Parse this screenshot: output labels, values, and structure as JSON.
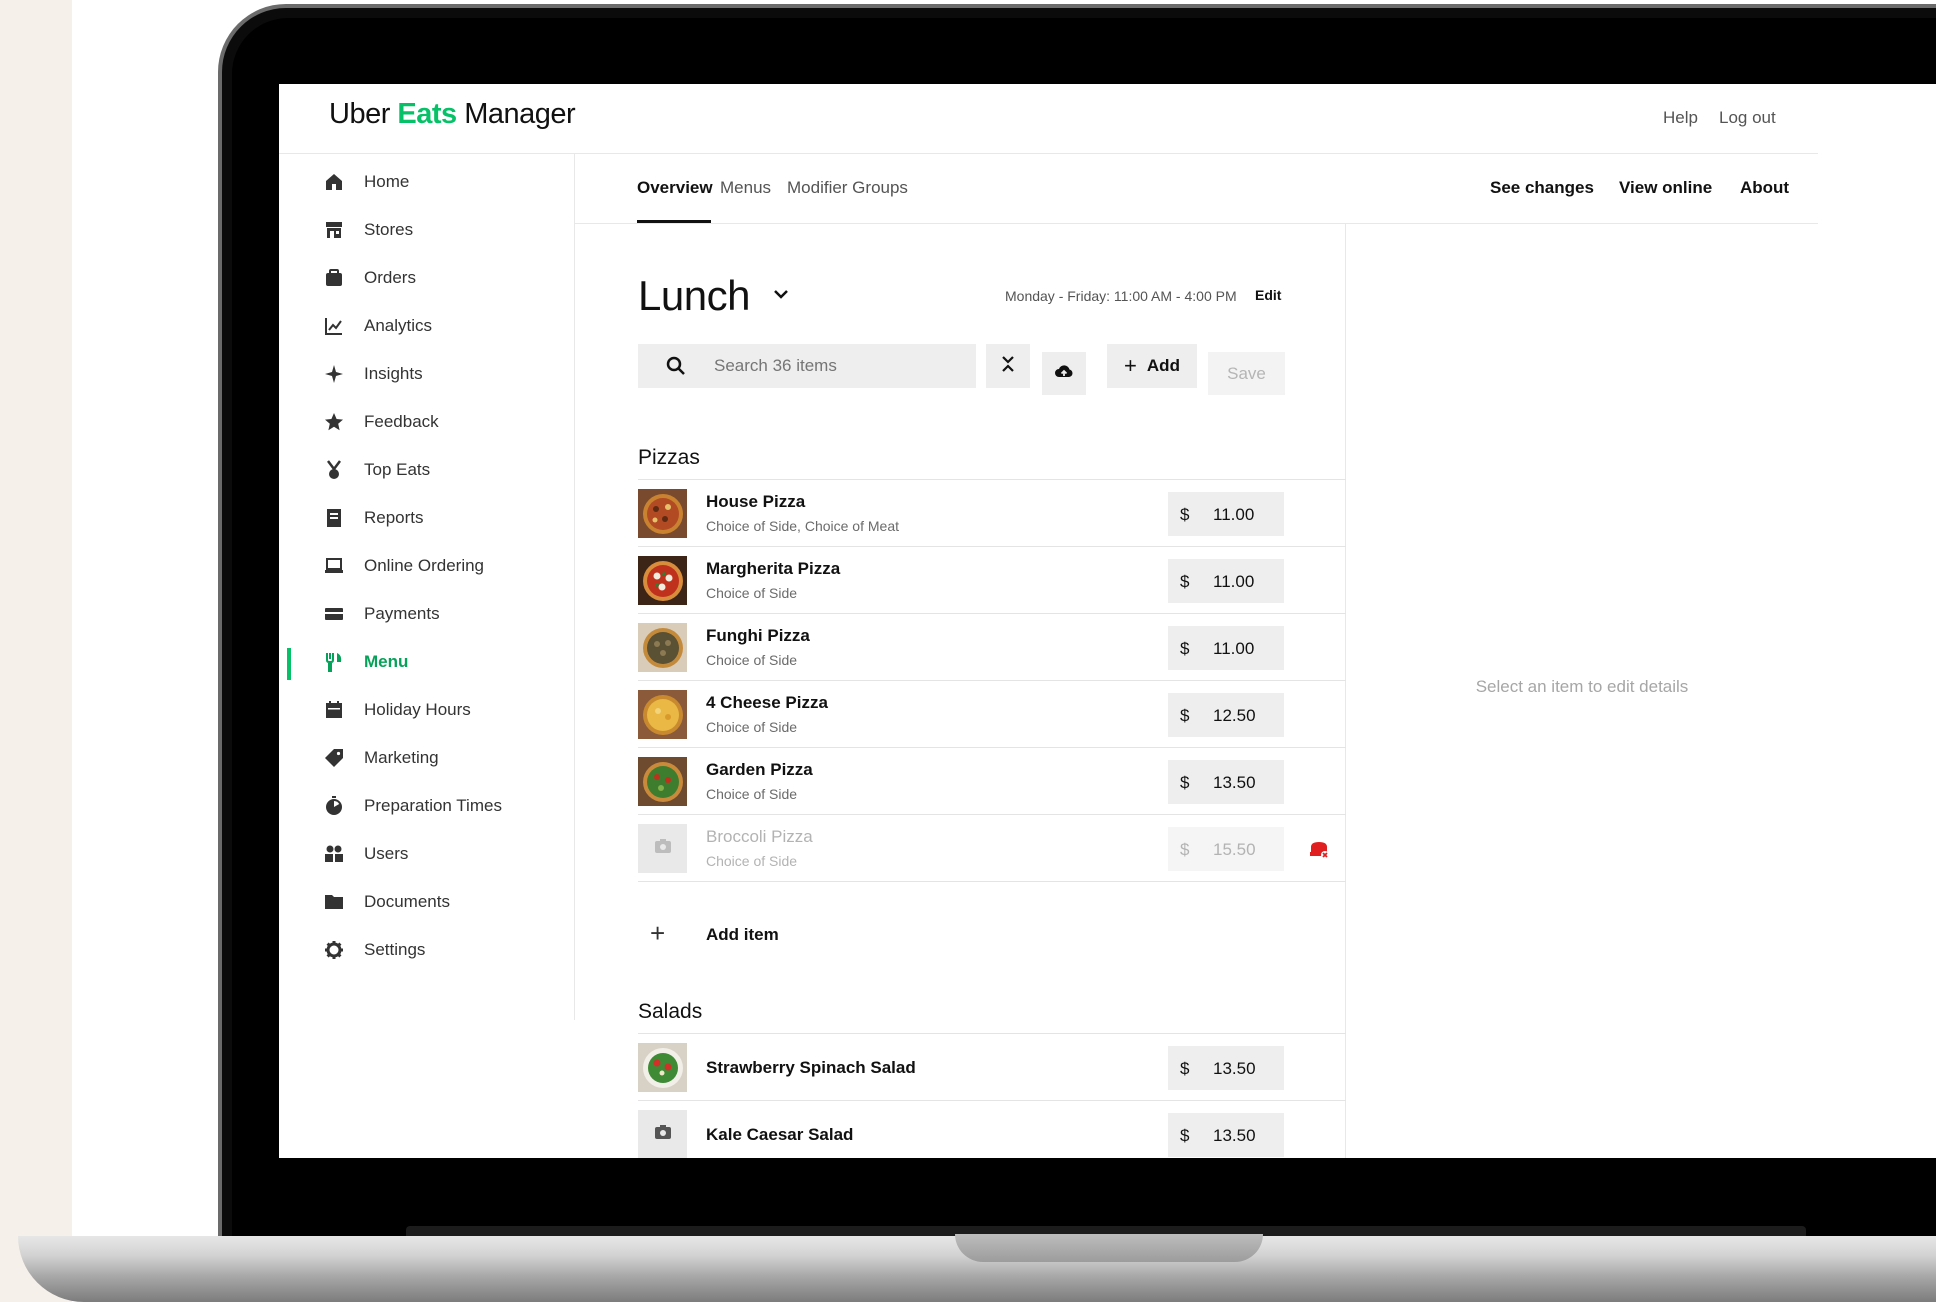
{
  "brand": {
    "logo_prefix": "Uber",
    "logo_eats": "Eats",
    "logo_suffix": "Manager",
    "accent_color": "#06c167"
  },
  "header": {
    "help": "Help",
    "logout": "Log out"
  },
  "sidebar": {
    "items": [
      {
        "label": "Home",
        "icon": "home-icon"
      },
      {
        "label": "Stores",
        "icon": "store-icon"
      },
      {
        "label": "Orders",
        "icon": "bag-icon"
      },
      {
        "label": "Analytics",
        "icon": "chart-icon"
      },
      {
        "label": "Insights",
        "icon": "sparkle-icon"
      },
      {
        "label": "Feedback",
        "icon": "star-icon"
      },
      {
        "label": "Top Eats",
        "icon": "medal-icon"
      },
      {
        "label": "Reports",
        "icon": "report-icon"
      },
      {
        "label": "Online Ordering",
        "icon": "laptop-icon"
      },
      {
        "label": "Payments",
        "icon": "card-icon"
      },
      {
        "label": "Menu",
        "icon": "utensils-icon",
        "active": true
      },
      {
        "label": "Holiday Hours",
        "icon": "calendar-icon"
      },
      {
        "label": "Marketing",
        "icon": "tag-icon"
      },
      {
        "label": "Preparation Times",
        "icon": "timer-icon"
      },
      {
        "label": "Users",
        "icon": "users-icon"
      },
      {
        "label": "Documents",
        "icon": "folder-icon"
      },
      {
        "label": "Settings",
        "icon": "gear-icon"
      }
    ]
  },
  "tabs": {
    "overview": "Overview",
    "menus": "Menus",
    "modifier_groups": "Modifier Groups",
    "see_changes": "See changes",
    "view_online": "View online",
    "about": "About"
  },
  "menu": {
    "title": "Lunch",
    "schedule": "Monday - Friday: 11:00 AM - 4:00 PM",
    "edit": "Edit",
    "search_placeholder": "Search 36 items",
    "add_label": "Add",
    "save_label": "Save",
    "add_item_label": "Add item"
  },
  "sections": [
    {
      "title": "Pizzas",
      "items": [
        {
          "name": "House Pizza",
          "modifiers": "Choice of Side, Choice of Meat",
          "currency": "$",
          "price": "11.00"
        },
        {
          "name": "Margherita Pizza",
          "modifiers": "Choice of Side",
          "currency": "$",
          "price": "11.00"
        },
        {
          "name": "Funghi Pizza",
          "modifiers": "Choice of Side",
          "currency": "$",
          "price": "11.00"
        },
        {
          "name": "4 Cheese Pizza",
          "modifiers": "Choice of Side",
          "currency": "$",
          "price": "12.50"
        },
        {
          "name": "Garden Pizza",
          "modifiers": "Choice of Side",
          "currency": "$",
          "price": "13.50"
        },
        {
          "name": "Broccoli Pizza",
          "modifiers": "Choice of Side",
          "currency": "$",
          "price": "15.50",
          "disabled": true
        }
      ]
    },
    {
      "title": "Salads",
      "items": [
        {
          "name": "Strawberry Spinach Salad",
          "currency": "$",
          "price": "13.50"
        },
        {
          "name": "Kale Caesar Salad",
          "currency": "$",
          "price": "13.50"
        }
      ]
    }
  ],
  "detail": {
    "empty_text": "Select an item to edit details"
  }
}
